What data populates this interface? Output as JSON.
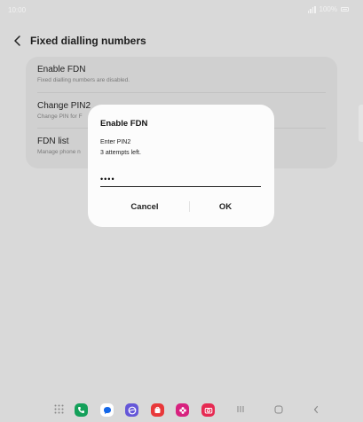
{
  "status_bar": {
    "time": "10:00",
    "battery": "100%"
  },
  "header": {
    "title": "Fixed dialling numbers"
  },
  "settings": [
    {
      "label": "Enable FDN",
      "sub": "Fixed dialling numbers are disabled."
    },
    {
      "label": "Change PIN2",
      "sub": "Change PIN for F"
    },
    {
      "label": "FDN list",
      "sub": "Manage phone n"
    }
  ],
  "dialog": {
    "title": "Enable FDN",
    "message_line1": "Enter PIN2",
    "message_line2": "3 attempts left.",
    "pin_value": "••••",
    "cancel_label": "Cancel",
    "ok_label": "OK"
  },
  "dock": {
    "apps": [
      "phone-app-icon",
      "messages-app-icon",
      "internet-app-icon",
      "galaxy-store-icon",
      "gallery-app-icon",
      "camera-app-icon"
    ]
  },
  "colors": {
    "accent_blue": "#0381fe",
    "dialog_bg": "#fcfcfc",
    "scrim": "#d9d9d9"
  }
}
